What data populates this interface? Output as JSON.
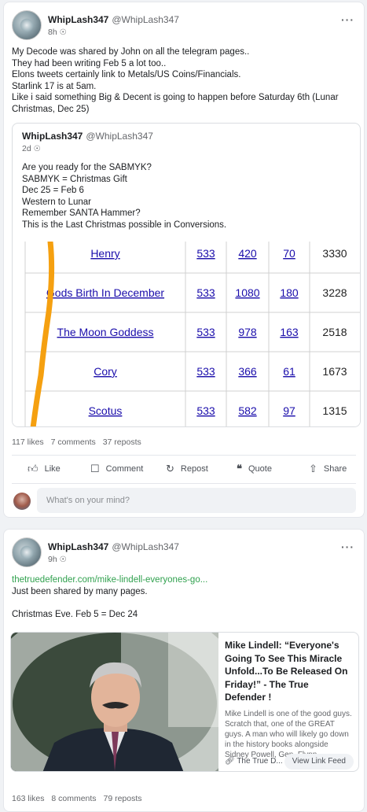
{
  "post1": {
    "author": "WhipLash347",
    "handle": "@WhipLash347",
    "time": "8h",
    "globe_icon": "globe-icon",
    "more": "···",
    "lines": [
      "My Decode was shared by John on all the telegram pages..",
      "They had been writing Feb 5 a lot too..",
      "Elons tweets certainly link to Metals/US Coins/Financials.",
      "Starlink 17 is at 5am.",
      "Like i said something Big & Decent is going to happen before Saturday 6th (Lunar",
      "Christmas, Dec 25)"
    ],
    "quote": {
      "author": "WhipLash347",
      "handle": "@WhipLash347",
      "time": "2d",
      "lines": [
        "Are you ready for the SABMYK?",
        "SABMYK = Christmas Gift",
        "Dec 25 = Feb 6",
        "Western to Lunar",
        "Remember SANTA Hammer?",
        "This is the Last Christmas possible in Conversions."
      ],
      "table_rows": [
        {
          "phrase": "Henry",
          "v1": "533",
          "v2": "420",
          "v3": "70",
          "v4": "3330"
        },
        {
          "phrase": "Gods Birth In December",
          "v1": "533",
          "v2": "1080",
          "v3": "180",
          "v4": "3228"
        },
        {
          "phrase": "The Moon Goddess",
          "v1": "533",
          "v2": "978",
          "v3": "163",
          "v4": "2518"
        },
        {
          "phrase": "Cory",
          "v1": "533",
          "v2": "366",
          "v3": "61",
          "v4": "1673"
        },
        {
          "phrase": "Scotus",
          "v1": "533",
          "v2": "582",
          "v3": "97",
          "v4": "1315"
        }
      ]
    },
    "stats": {
      "likes": "117 likes",
      "comments": "7 comments",
      "reposts": "37 reposts"
    },
    "actions": {
      "like": "Like",
      "comment": "Comment",
      "repost": "Repost",
      "quote": "Quote",
      "share": "Share"
    },
    "composer_placeholder": "What's on your mind?"
  },
  "post2": {
    "author": "WhipLash347",
    "handle": "@WhipLash347",
    "time": "9h",
    "more": "···",
    "link": "thetruedefender.com/mike-lindell-everyones-go...",
    "lines": [
      "Just been shared by many pages.",
      "",
      "Christmas Eve. Feb 5 = Dec 24"
    ],
    "preview": {
      "title": "Mike Lindell: “Everyone's Going To See This Miracle Unfold...To Be Released On Friday!” - The True Defender !",
      "description": "Mike Lindell is one of the good guys. Scratch that, one of the GREAT guys. A man who will likely go down in the history books alongside Sidney Powell, Gen. Flynn,...",
      "source": "The True D...",
      "button": "View Link Feed"
    },
    "stats": {
      "likes": "163 likes",
      "comments": "8 comments",
      "reposts": "79 reposts"
    }
  },
  "colors": {
    "link": "#30a14e",
    "table_link": "#1a0dab",
    "marker": "#f5a010"
  }
}
